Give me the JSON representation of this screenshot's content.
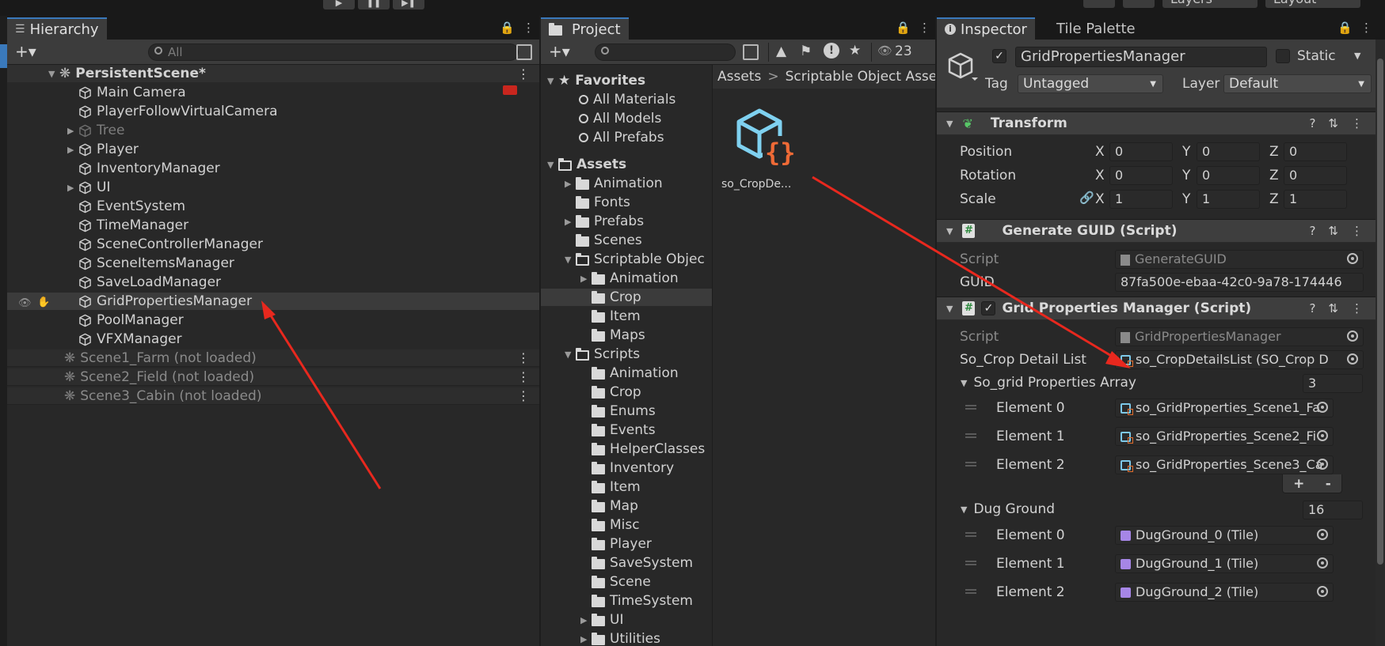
{
  "toolbar": {
    "play": "▶",
    "pause": "❚❚",
    "step": "▶❚",
    "layers_label": "Layers",
    "layout_label": "Layout"
  },
  "hierarchy": {
    "tab_label": "Hierarchy",
    "search_placeholder": "All",
    "scene": "PersistentScene*",
    "items": [
      {
        "label": "Main Camera",
        "arrow": ""
      },
      {
        "label": "PlayerFollowVirtualCamera",
        "arrow": ""
      },
      {
        "label": "Tree",
        "arrow": "▶"
      },
      {
        "label": "Player",
        "arrow": "▶"
      },
      {
        "label": "InventoryManager",
        "arrow": ""
      },
      {
        "label": "UI",
        "arrow": "▶"
      },
      {
        "label": "EventSystem",
        "arrow": ""
      },
      {
        "label": "TimeManager",
        "arrow": ""
      },
      {
        "label": "SceneControllerManager",
        "arrow": ""
      },
      {
        "label": "SceneItemsManager",
        "arrow": ""
      },
      {
        "label": "SaveLoadManager",
        "arrow": ""
      },
      {
        "label": "GridPropertiesManager",
        "arrow": ""
      },
      {
        "label": "PoolManager",
        "arrow": ""
      },
      {
        "label": "VFXManager",
        "arrow": ""
      }
    ],
    "unloaded_scenes": [
      "Scene1_Farm (not loaded)",
      "Scene2_Field (not loaded)",
      "Scene3_Cabin (not loaded)"
    ]
  },
  "project": {
    "tab_label": "Project",
    "hidden_count": "23",
    "favorites_label": "Favorites",
    "favorites": [
      "All Materials",
      "All Models",
      "All Prefabs"
    ],
    "assets_label": "Assets",
    "asset_folders": [
      {
        "label": "Animation",
        "arrow": "▶",
        "depth": 1
      },
      {
        "label": "Fonts",
        "arrow": "",
        "depth": 1
      },
      {
        "label": "Prefabs",
        "arrow": "▶",
        "depth": 1
      },
      {
        "label": "Scenes",
        "arrow": "",
        "depth": 1
      },
      {
        "label": "Scriptable Objec",
        "arrow": "▼",
        "depth": 1
      },
      {
        "label": "Animation",
        "arrow": "▶",
        "depth": 2
      },
      {
        "label": "Crop",
        "arrow": "",
        "depth": 2
      },
      {
        "label": "Item",
        "arrow": "",
        "depth": 2
      },
      {
        "label": "Maps",
        "arrow": "",
        "depth": 2
      },
      {
        "label": "Scripts",
        "arrow": "▼",
        "depth": 1
      },
      {
        "label": "Animation",
        "arrow": "",
        "depth": 2
      },
      {
        "label": "Crop",
        "arrow": "",
        "depth": 2
      },
      {
        "label": "Enums",
        "arrow": "",
        "depth": 2
      },
      {
        "label": "Events",
        "arrow": "",
        "depth": 2
      },
      {
        "label": "HelperClasses",
        "arrow": "",
        "depth": 2
      },
      {
        "label": "Inventory",
        "arrow": "",
        "depth": 2
      },
      {
        "label": "Item",
        "arrow": "",
        "depth": 2
      },
      {
        "label": "Map",
        "arrow": "",
        "depth": 2
      },
      {
        "label": "Misc",
        "arrow": "",
        "depth": 2
      },
      {
        "label": "Player",
        "arrow": "",
        "depth": 2
      },
      {
        "label": "SaveSystem",
        "arrow": "",
        "depth": 2
      },
      {
        "label": "Scene",
        "arrow": "",
        "depth": 2
      },
      {
        "label": "TimeSystem",
        "arrow": "",
        "depth": 2
      },
      {
        "label": "UI",
        "arrow": "▶",
        "depth": 2
      },
      {
        "label": "Utilities",
        "arrow": "▶",
        "depth": 2
      }
    ],
    "breadcrumb_root": "Assets",
    "breadcrumb_sep": ">",
    "breadcrumb_child": "Scriptable Object Asse",
    "asset_name": "so_CropDe..."
  },
  "inspector": {
    "tab_label": "Inspector",
    "tab2_label": "Tile Palette",
    "object_name": "GridPropertiesManager",
    "static_label": "Static",
    "tag_label": "Tag",
    "tag_value": "Untagged",
    "layer_label": "Layer",
    "layer_value": "Default",
    "transform": {
      "title": "Transform",
      "position_label": "Position",
      "rotation_label": "Rotation",
      "scale_label": "Scale",
      "axis_x": "X",
      "axis_y": "Y",
      "axis_z": "Z",
      "position": [
        "0",
        "0",
        "0"
      ],
      "rotation": [
        "0",
        "0",
        "0"
      ],
      "scale": [
        "1",
        "1",
        "1"
      ]
    },
    "generate_guid": {
      "title": "Generate GUID (Script)",
      "script_label": "Script",
      "script_value": "GenerateGUID",
      "guid_label": "GUID",
      "guid_value": "87fa500e-ebaa-42c0-9a78-174446"
    },
    "gpm": {
      "title": "Grid Properties Manager (Script)",
      "script_label": "Script",
      "script_value": "GridPropertiesManager",
      "crop_label": "So_Crop Detail List",
      "crop_value": "so_CropDetailsList (SO_Crop D",
      "array_label": "So_grid Properties Array",
      "array_size": "3",
      "array_items": [
        {
          "label": "Element 0",
          "value": "so_GridProperties_Scene1_Fa"
        },
        {
          "label": "Element 1",
          "value": "so_GridProperties_Scene2_Fi"
        },
        {
          "label": "Element 2",
          "value": "so_GridProperties_Scene3_Ca"
        }
      ],
      "plus": "+",
      "minus": "-",
      "dug_label": "Dug Ground",
      "dug_size": "16",
      "dug_items": [
        {
          "label": "Element 0",
          "value": "DugGround_0 (Tile)"
        },
        {
          "label": "Element 1",
          "value": "DugGround_1 (Tile)"
        },
        {
          "label": "Element 2",
          "value": "DugGround_2 (Tile)"
        }
      ]
    }
  },
  "colors": {
    "annotation_arrow": "#e8281e",
    "selection_bg": "#3b3b3b",
    "panel_bg": "#282828"
  }
}
